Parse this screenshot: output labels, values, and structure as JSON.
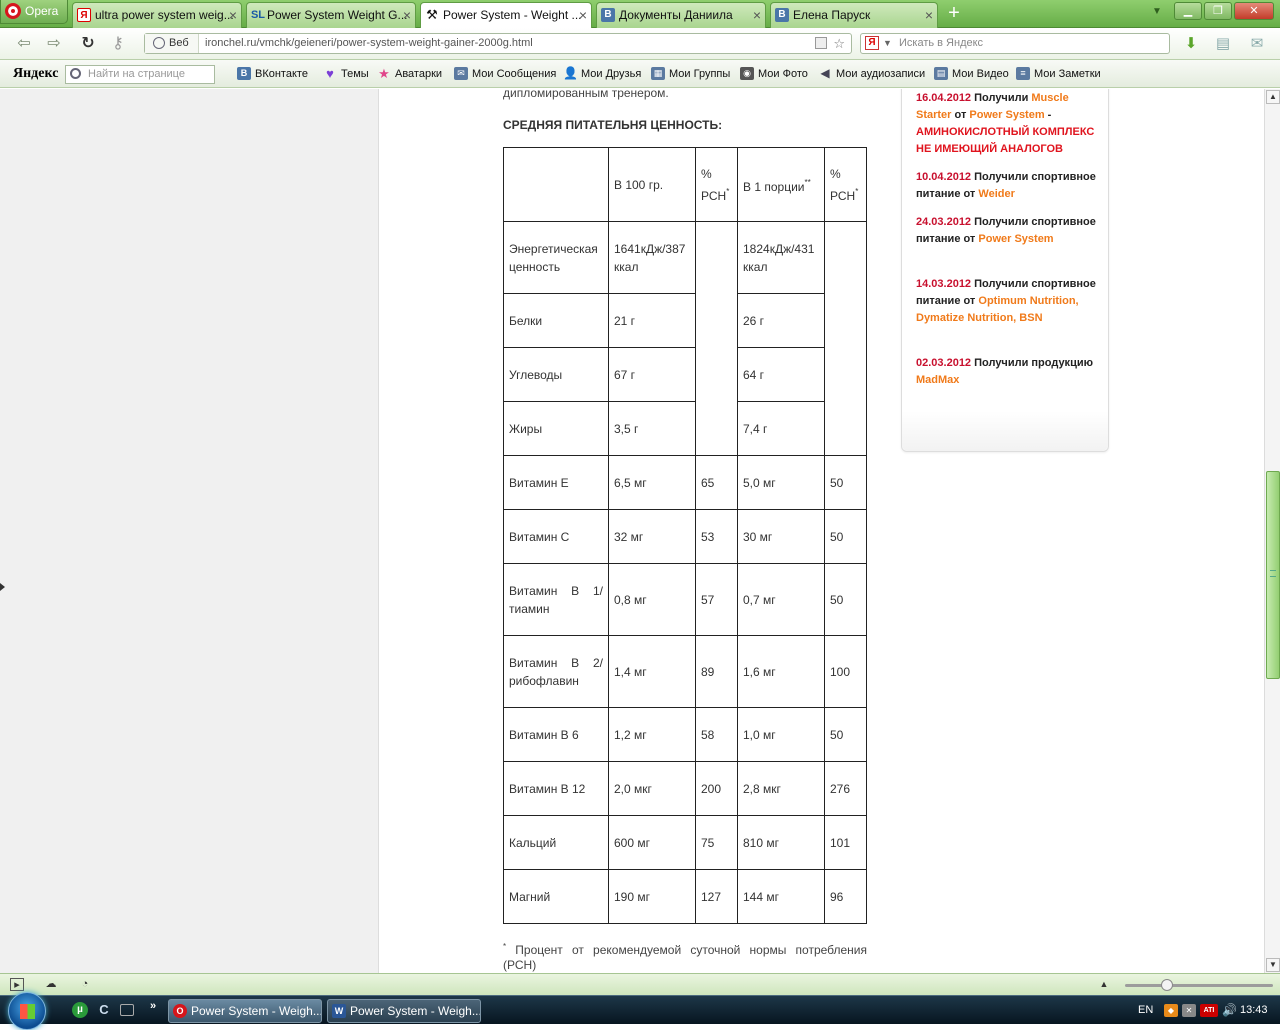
{
  "browser": {
    "menu_label": "Opera",
    "tabs": [
      {
        "label": "ultra power system weig...",
        "favicon": "Я"
      },
      {
        "label": "Power System Weight G...",
        "favicon": "SL"
      },
      {
        "label": "Power System - Weight ...",
        "favicon": "⚒"
      },
      {
        "label": "Документы Даниила",
        "favicon": "В"
      },
      {
        "label": "Елена Паруск",
        "favicon": "В"
      }
    ],
    "new_tab_icon": "+",
    "web_label": "Веб",
    "url": "ironchel.ru/vmchk/geieneri/power-system-weight-gainer-2000g.html",
    "search_placeholder": "Искать в Яндекс",
    "search_engine_letter": "Я",
    "tab_close_glyph": "×"
  },
  "yandex_bar": {
    "logo_main": "Яндекс",
    "find_placeholder": "Найти на странице",
    "links": [
      "ВКонтакте",
      "Темы",
      "Аватарки",
      "Мои Сообщения",
      "Мои Друзья",
      "Мои Группы",
      "Мои Фото",
      "Мои аудиозаписи",
      "Мои Видео",
      "Мои Заметки"
    ],
    "vk_letter": "В"
  },
  "article": {
    "intro_tail": "дипломированным тренером.",
    "table_heading": "СРЕДНЯЯ ПИТАТЕЛЬНЯ ЦЕННОСТЬ:",
    "header": {
      "col100": "В 100 гр.",
      "pct": "%",
      "pct_unit": "РСН",
      "pct_mark": "*",
      "portion": "В 1 порции",
      "portion_mark": "**"
    },
    "macros": [
      {
        "name": "Энергетическая ценность",
        "per100": "1641кДж/387 ккал",
        "portion": "1824кДж/431 ккал"
      },
      {
        "name": "Белки",
        "per100": "21 г",
        "portion": "26 г"
      },
      {
        "name": "Углеводы",
        "per100": "67 г",
        "portion": "64 г"
      },
      {
        "name": "Жиры",
        "per100": "3,5 г",
        "portion": "7,4 г"
      }
    ],
    "vitamins": [
      {
        "name": "Витамин Е",
        "per100": "6,5 мг",
        "pct100": "65",
        "portion": "5,0 мг",
        "pctp": "50"
      },
      {
        "name": "Витамин С",
        "per100": "32 мг",
        "pct100": "53",
        "portion": "30 мг",
        "pctp": "50"
      },
      {
        "name": "Витамин В 1/ тиамин",
        "per100": "0,8 мг",
        "pct100": "57",
        "portion": "0,7 мг",
        "pctp": "50"
      },
      {
        "name": "Витамин В 2/ рибофлавин",
        "per100": "1,4 мг",
        "pct100": "89",
        "portion": "1,6 мг",
        "pctp": "100"
      },
      {
        "name": "Витамин В 6",
        "per100": "1,2 мг",
        "pct100": "58",
        "portion": "1,0 мг",
        "pctp": "50"
      },
      {
        "name": "Витамин В 12",
        "per100": "2,0 мкг",
        "pct100": "200",
        "portion": "2,8 мкг",
        "pctp": "276"
      },
      {
        "name": "Кальций",
        "per100": "600 мг",
        "pct100": "75",
        "portion": "810 мг",
        "pctp": "101"
      },
      {
        "name": "Магний",
        "per100": "190 мг",
        "pct100": "127",
        "portion": "144 мг",
        "pctp": "96"
      }
    ],
    "footnote_mark": "*",
    "footnote_line1": "Процент от рекомендуемой суточной нормы потребления",
    "footnote_line2": "(РСН)"
  },
  "news": [
    {
      "date": "16.04.2012",
      "parts": [
        {
          "t": " Получили ",
          "c": ""
        },
        {
          "t": "Muscle Starter",
          "c": "o"
        },
        {
          "t": " от ",
          "c": ""
        },
        {
          "t": "Power System",
          "c": "o"
        },
        {
          "t": " - ",
          "c": ""
        },
        {
          "t": "АМИНОКИСЛОТНЫЙ КОМПЛЕКС НЕ ИМЕЮЩИЙ АНАЛОГОВ",
          "c": "r"
        }
      ]
    },
    {
      "date": "10.04.2012",
      "parts": [
        {
          "t": " Получили спортивное питание от ",
          "c": ""
        },
        {
          "t": "Weider",
          "c": "o"
        }
      ]
    },
    {
      "date": "24.03.2012",
      "parts": [
        {
          "t": " Получили спортивное питание от ",
          "c": ""
        },
        {
          "t": "Power System",
          "c": "o"
        }
      ]
    },
    {
      "date": "14.03.2012",
      "parts": [
        {
          "t": " Получили спортивное питание от ",
          "c": ""
        },
        {
          "t": "Optimum Nutrition, Dymatize Nutrition, BSN",
          "c": "o"
        }
      ]
    },
    {
      "date": "02.03.2012",
      "parts": [
        {
          "t": " Получили продукцию ",
          "c": ""
        },
        {
          "t": "MadMax",
          "c": "o"
        }
      ]
    }
  ],
  "taskbar": {
    "tasks": [
      "Power System - Weigh...",
      "Power System - Weigh..."
    ],
    "lang": "EN",
    "clock": "13:43",
    "ati_label": "ATI"
  },
  "colors": {
    "accent_green": "#66ad47",
    "news_date": "#c8102e",
    "news_link": "#f07a1a",
    "news_alert": "#e0141e"
  }
}
